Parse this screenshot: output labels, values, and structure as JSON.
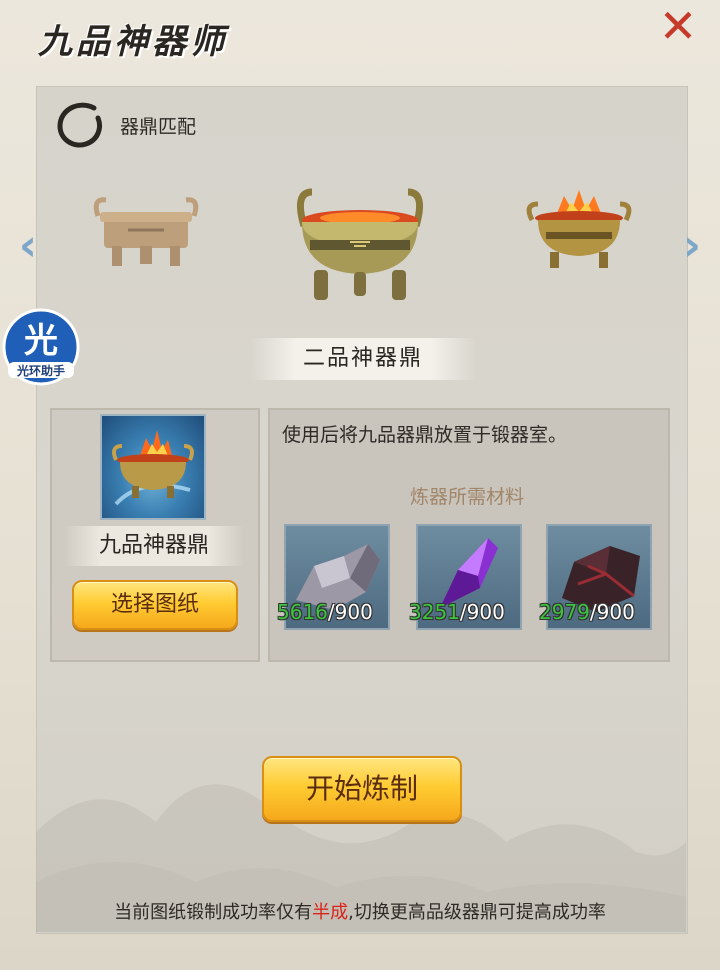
{
  "window": {
    "title": "九品神器师",
    "close_icon": "close-icon"
  },
  "section": {
    "title": "器鼎匹配"
  },
  "carousel": {
    "left_arrow": "‹",
    "right_arrow": "›",
    "selected_name": "二品神器鼎"
  },
  "badge": {
    "char": "光",
    "label": "光环助手"
  },
  "item": {
    "name": "九品神器鼎",
    "select_button": "选择图纸"
  },
  "description": "使用后将九品器鼎放置于锻器室。",
  "materials": {
    "title": "炼器所需材料",
    "items": [
      {
        "name": "silver-ore",
        "have": "5616",
        "need": "/900"
      },
      {
        "name": "purple-crystal",
        "have": "3251",
        "need": "/900"
      },
      {
        "name": "dark-red-ore",
        "have": "2979",
        "need": "/900"
      }
    ]
  },
  "start_button": "开始炼制",
  "tip": {
    "prefix": "当前图纸锻制成功率仅有",
    "highlight": "半成",
    "suffix": ",切换更高品级器鼎可提高成功率"
  },
  "colors": {
    "accent_gold": "#ffcc33",
    "close_red": "#c63a2a",
    "have_green": "#3dc43d",
    "highlight_red": "#d9241c"
  }
}
